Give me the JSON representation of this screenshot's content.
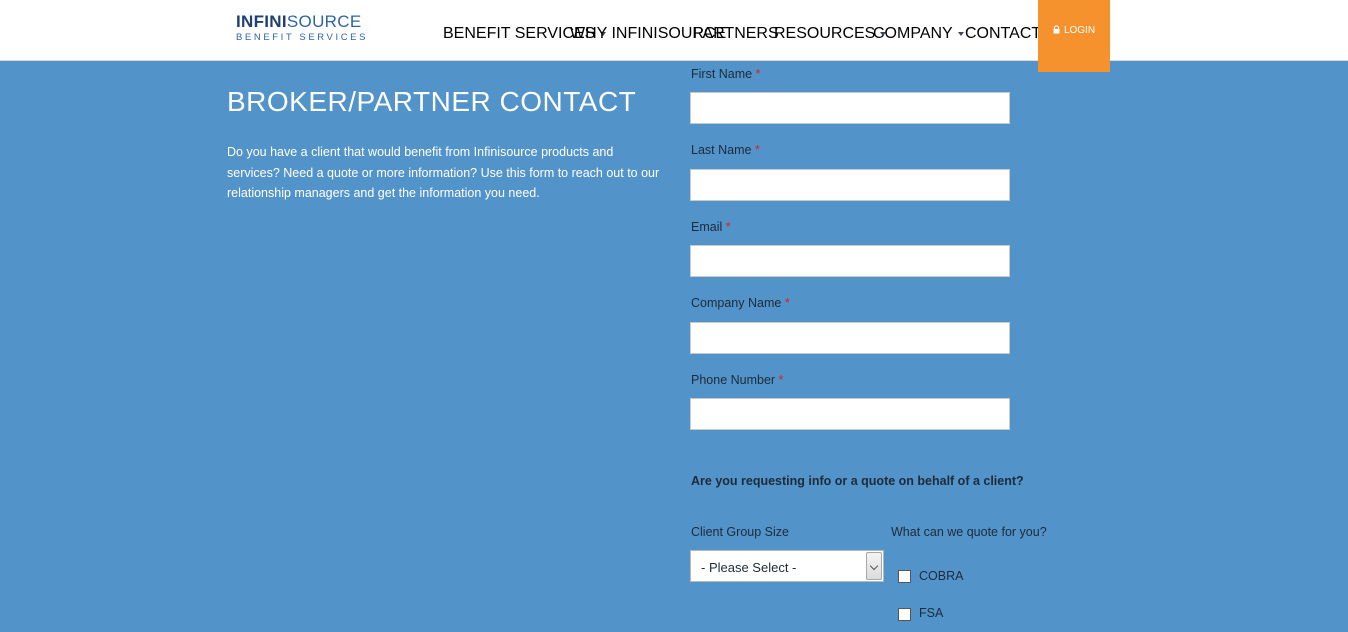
{
  "header": {
    "logo_top_a": "INFINI",
    "logo_top_b": "SOURCE",
    "logo_bottom": "BENEFIT SERVICES",
    "nav": [
      {
        "label": "BENEFIT SERVICES",
        "has_caret": true
      },
      {
        "label": "WHY INFINISOURCE",
        "has_caret": false
      },
      {
        "label": "PARTNERS",
        "has_caret": false
      },
      {
        "label": "RESOURCES",
        "has_caret": true
      },
      {
        "label": "COMPANY",
        "has_caret": true
      },
      {
        "label": "CONTACT",
        "has_caret": true
      }
    ],
    "login_label": "LOGIN",
    "login_icon": "lock-icon"
  },
  "page": {
    "title": "BROKER/PARTNER CONTACT",
    "intro": "Do you have a client that would benefit from Infinisource products and services? Need a quote or more information? Use this form to reach out to our relationship managers and get the information you need."
  },
  "form": {
    "required_mark": "*",
    "fields": [
      {
        "label": "First Name",
        "value": ""
      },
      {
        "label": "Last Name",
        "value": ""
      },
      {
        "label": "Email",
        "value": ""
      },
      {
        "label": "Company Name",
        "value": ""
      },
      {
        "label": "Phone Number",
        "value": ""
      }
    ],
    "question": "Are you requesting info or a quote on behalf of a client?",
    "group_size_label": "Client Group Size",
    "group_size_selected": "- Please Select -",
    "quote_label": "What can we quote for you?",
    "quote_options": [
      {
        "label": "COBRA",
        "checked": false
      },
      {
        "label": "FSA",
        "checked": false
      }
    ]
  },
  "colors": {
    "background": "#5293c9",
    "accent": "#f5922d",
    "required": "#e02020"
  }
}
